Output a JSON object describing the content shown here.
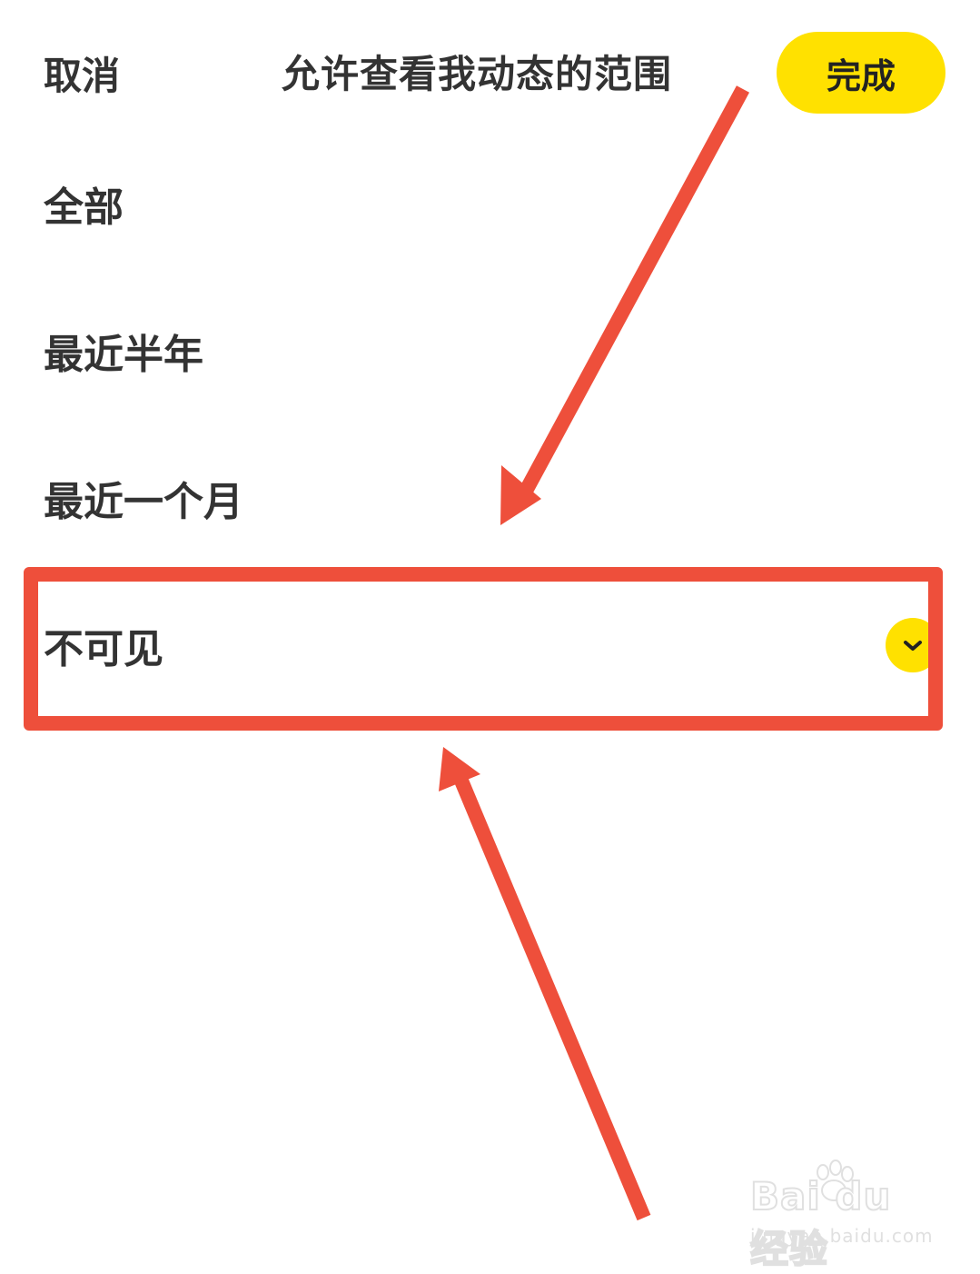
{
  "header": {
    "cancel_label": "取消",
    "title": "允许查看我动态的范围",
    "done_label": "完成"
  },
  "options": [
    {
      "label": "全部",
      "selected": false
    },
    {
      "label": "最近半年",
      "selected": false
    },
    {
      "label": "最近一个月",
      "selected": false
    },
    {
      "label": "不可见",
      "selected": true
    }
  ],
  "colors": {
    "accent_yellow": "#ffe100",
    "annotation_red": "#ee4f3b",
    "text": "#333333"
  },
  "icons": {
    "check": "checkmark-icon"
  },
  "watermark": {
    "brand": "Bai du 经验",
    "url": "jingyan.baidu.com"
  }
}
